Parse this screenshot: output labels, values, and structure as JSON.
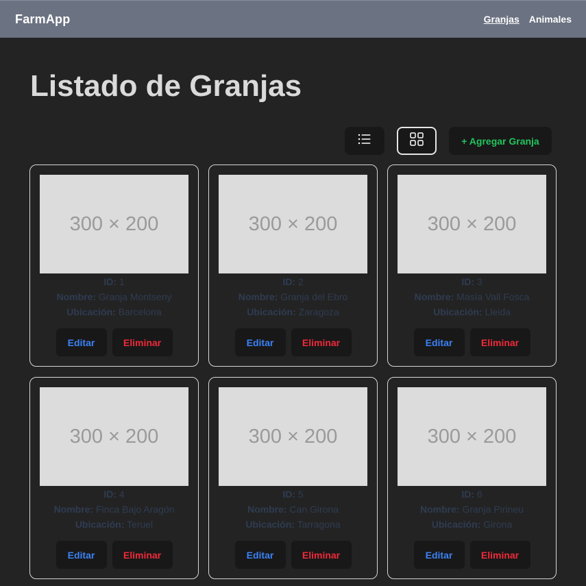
{
  "navbar": {
    "brand": "FarmApp",
    "links": [
      {
        "label": "Granjas",
        "active": true
      },
      {
        "label": "Animales",
        "active": false
      }
    ]
  },
  "page_title": "Listado de Granjas",
  "toolbar": {
    "list_view_icon": "list-icon",
    "grid_view_icon": "grid-icon",
    "grid_view_selected": true,
    "add_label": "+ Agregar Granja"
  },
  "labels": {
    "id": "ID:",
    "name": "Nombre:",
    "location": "Ubicación:",
    "edit": "Editar",
    "delete": "Eliminar",
    "placeholder": "300 × 200"
  },
  "farms": [
    {
      "id": "1",
      "name": "Granja Montseny",
      "location": "Barcelona"
    },
    {
      "id": "2",
      "name": "Granja del Ebro",
      "location": "Zaragoza"
    },
    {
      "id": "3",
      "name": "Masía Vall Fosca",
      "location": "Lleida"
    },
    {
      "id": "4",
      "name": "Finca Bajo Aragón",
      "location": "Teruel"
    },
    {
      "id": "5",
      "name": "Can Girona",
      "location": "Tarragona"
    },
    {
      "id": "6",
      "name": "Granja Pirineu",
      "location": "Girona"
    }
  ],
  "colors": {
    "navbar": "#6b7281",
    "background": "#232323",
    "add_accent": "#22c55e",
    "edit_accent": "#3b82f6",
    "delete_accent": "#ef2a3a"
  }
}
